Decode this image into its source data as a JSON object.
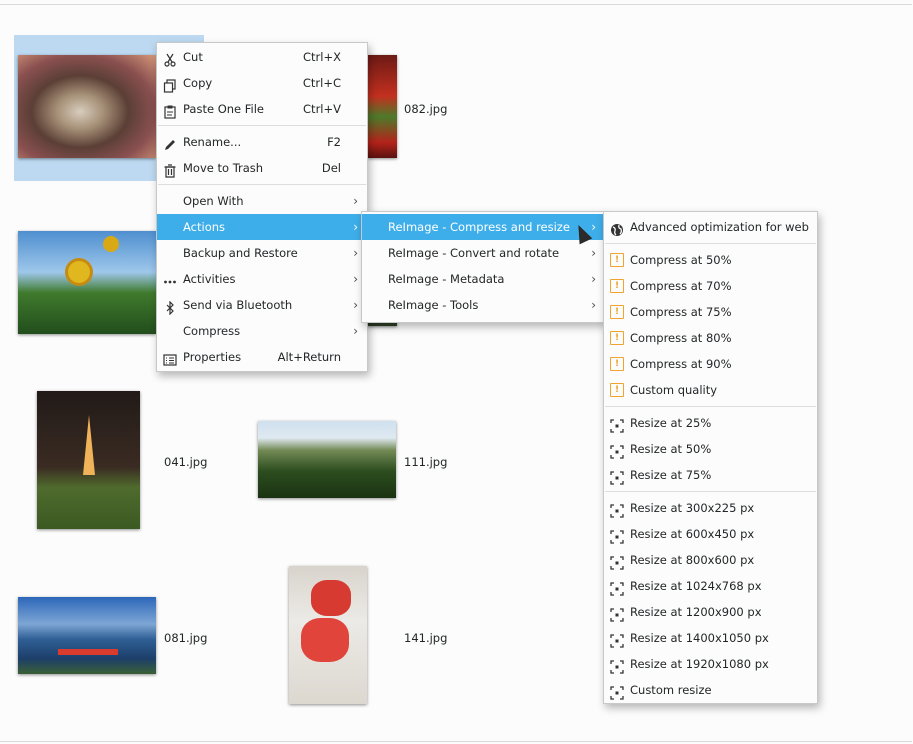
{
  "files": [
    {
      "name": ""
    },
    {
      "name": "082.jpg"
    },
    {
      "name": ""
    },
    {
      "name": "041.jpg"
    },
    {
      "name": "111.jpg"
    },
    {
      "name": "081.jpg"
    },
    {
      "name": "141.jpg"
    }
  ],
  "context_menu": {
    "items": [
      {
        "label": "Cut",
        "shortcut": "Ctrl+X",
        "icon": "scissors-icon"
      },
      {
        "label": "Copy",
        "shortcut": "Ctrl+C",
        "icon": "copy-icon"
      },
      {
        "label": "Paste One File",
        "shortcut": "Ctrl+V",
        "icon": "paste-icon"
      },
      {
        "label": "Rename...",
        "shortcut": "F2",
        "icon": "pencil-icon"
      },
      {
        "label": "Move to Trash",
        "shortcut": "Del",
        "icon": "trash-icon"
      },
      {
        "label": "Open With"
      },
      {
        "label": "Actions"
      },
      {
        "label": "Backup and Restore"
      },
      {
        "label": "Activities",
        "icon": "dots-icon"
      },
      {
        "label": "Send via Bluetooth",
        "icon": "bluetooth-icon"
      },
      {
        "label": "Compress"
      },
      {
        "label": "Properties",
        "shortcut": "Alt+Return",
        "icon": "properties-icon"
      }
    ]
  },
  "actions_menu": {
    "items": [
      {
        "label": "ReImage - Compress and resize"
      },
      {
        "label": "ReImage - Convert and rotate"
      },
      {
        "label": "ReImage - Metadata"
      },
      {
        "label": "ReImage - Tools"
      }
    ]
  },
  "reimage_menu": {
    "web": "Advanced optimization for web",
    "compress": [
      "Compress at 50%",
      "Compress at 70%",
      "Compress at 75%",
      "Compress at 80%",
      "Compress at 90%",
      "Custom quality"
    ],
    "resize_pct": [
      "Resize at 25%",
      "Resize at 50%",
      "Resize at 75%"
    ],
    "resize_px": [
      "Resize at 300x225 px",
      "Resize at 600x450 px",
      "Resize at 800x600 px",
      "Resize at 1024x768 px",
      "Resize at 1200x900 px",
      "Resize at 1400x1050 px",
      "Resize at 1920x1080 px",
      "Custom resize"
    ]
  },
  "colors": {
    "highlight": "#3daee9",
    "selection": "#bcd9f1",
    "warning_icon": "#f0a32d"
  }
}
